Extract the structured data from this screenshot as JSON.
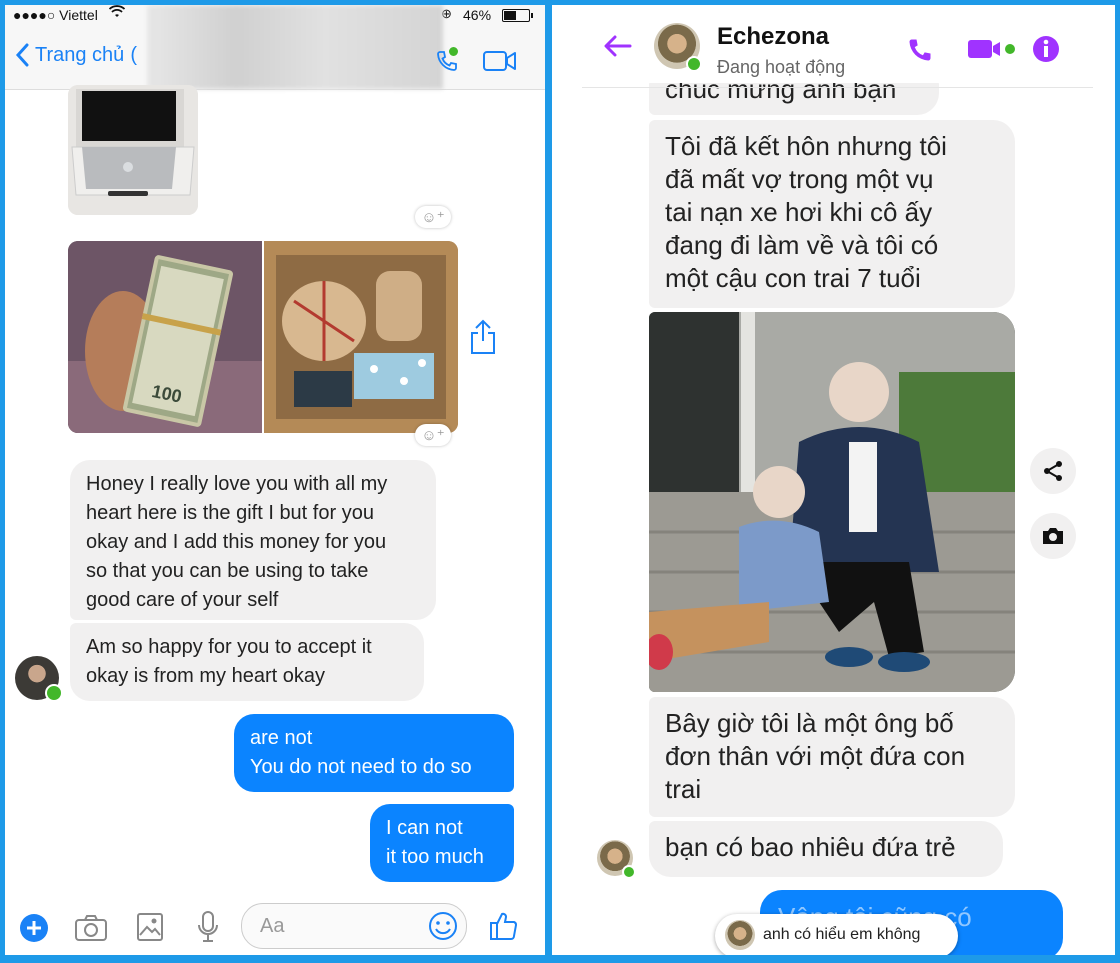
{
  "left": {
    "status_bar": {
      "carrier": "●●●●○ Viettel",
      "battery": "46%",
      "battery_level": 0.46
    },
    "nav": {
      "back_label": "Trang chủ",
      "back_extra": "("
    },
    "messages": {
      "honey": "Honey I really love you with all my\nheart here is the gift I but for you\nokay and I add this money for you\nso that you can be using to take\ngood care of your self",
      "happy": "Am so happy for you to accept it\nokay is from my heart okay",
      "are_not": "are not\nYou do not need to do so",
      "i_can_not": "I can not\nit too much"
    },
    "composer": {
      "placeholder": "Aa"
    }
  },
  "right": {
    "contact": {
      "name": "Echezona",
      "status": "Đang hoạt động"
    },
    "messages": {
      "m1": "chúc mừng anh bạn",
      "m2": "Tôi đã kết hôn nhưng tôi\nđã mất vợ trong một vụ\ntai nạn xe hơi khi cô ấy\nđang đi làm về và tôi có\nmột cậu con trai 7 tuổi",
      "m3": "Bây giờ tôi là một ông bố\nđơn thân với một đứa con\ntrai",
      "m4": "bạn có bao nhiêu đứa trẻ",
      "outgoing_partial": "Vâng tôi cũng có"
    },
    "notification": "anh có hiểu em không"
  },
  "colors": {
    "messenger_blue": "#0b84ff",
    "purple": "#a033ff",
    "online_green": "#42b72a",
    "frame": "#1e9ae8"
  }
}
